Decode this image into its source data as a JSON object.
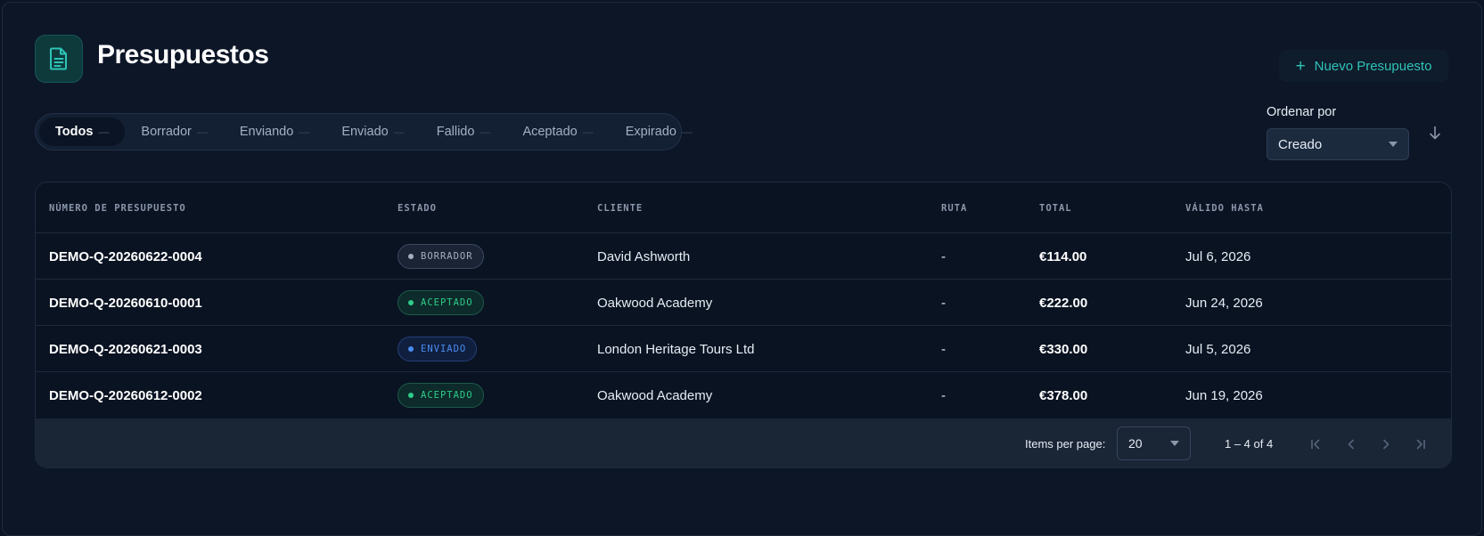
{
  "header": {
    "title": "Presupuestos",
    "icon": "document-icon",
    "new_button": "Nuevo Presupuesto",
    "accent_color": "#2ec4b6"
  },
  "tabs": [
    {
      "label": "Todos",
      "count": "—",
      "active": true
    },
    {
      "label": "Borrador",
      "count": "—"
    },
    {
      "label": "Enviando",
      "count": "—"
    },
    {
      "label": "Enviado",
      "count": "—"
    },
    {
      "label": "Fallido",
      "count": "—"
    },
    {
      "label": "Aceptado",
      "count": "—"
    },
    {
      "label": "Expirado",
      "count": "—"
    }
  ],
  "sort": {
    "label": "Ordenar por",
    "value": "Creado",
    "direction_icon": "arrow-down-icon"
  },
  "table": {
    "columns": [
      "NÚMERO DE PRESUPUESTO",
      "ESTADO",
      "CLIENTE",
      "RUTA",
      "TOTAL",
      "VÁLIDO HASTA"
    ],
    "rows": [
      {
        "number": "DEMO-Q-20260622-0004",
        "status": "BORRADOR",
        "status_key": "borrador",
        "client": "David Ashworth",
        "route": "-",
        "total": "€114.00",
        "valid_until": "Jul 6, 2026"
      },
      {
        "number": "DEMO-Q-20260610-0001",
        "status": "ACEPTADO",
        "status_key": "aceptado",
        "client": "Oakwood Academy",
        "route": "-",
        "total": "€222.00",
        "valid_until": "Jun 24, 2026"
      },
      {
        "number": "DEMO-Q-20260621-0003",
        "status": "ENVIADO",
        "status_key": "enviado",
        "client": "London Heritage Tours Ltd",
        "route": "-",
        "total": "€330.00",
        "valid_until": "Jul 5, 2026"
      },
      {
        "number": "DEMO-Q-20260612-0002",
        "status": "ACEPTADO",
        "status_key": "aceptado",
        "client": "Oakwood Academy",
        "route": "-",
        "total": "€378.00",
        "valid_until": "Jun 19, 2026"
      }
    ]
  },
  "paginator": {
    "items_per_page_label": "Items per page:",
    "items_per_page": "20",
    "range": "1 – 4 of 4"
  },
  "status_colors": {
    "borrador": "#a3b0c2",
    "aceptado": "#2ecc8a",
    "enviado": "#4a8cf0"
  }
}
